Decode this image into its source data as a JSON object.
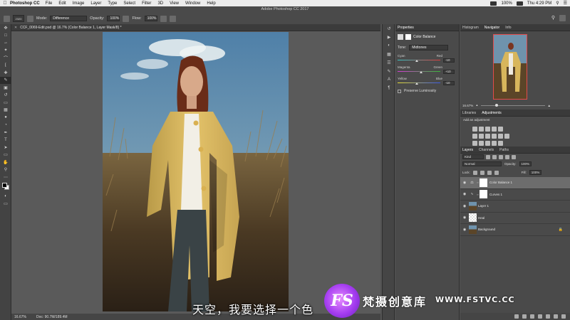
{
  "menubar": {
    "app_name": "Photoshop CC",
    "items": [
      "File",
      "Edit",
      "Image",
      "Layer",
      "Type",
      "Select",
      "Filter",
      "3D",
      "View",
      "Window",
      "Help"
    ],
    "battery": "100%",
    "clock": "Thu 4:29 PM"
  },
  "window_title": "Adobe Photoshop CC 2017",
  "optionsbar": {
    "brush_size": "2320",
    "mode_label": "Mode:",
    "mode_value": "Difference",
    "opacity_label": "Opacity:",
    "opacity_value": "100%",
    "flow_label": "Flow:",
    "flow_value": "100%"
  },
  "document": {
    "tab_label": "CCF_0069-Edit.psd @ 16.7% (Color Balance 1, Layer Mask/8) *"
  },
  "statusbar": {
    "zoom": "16.67%",
    "doc": "Doc: 90.7M/189.4M"
  },
  "properties": {
    "tabs": [
      "Properties"
    ],
    "title": "Color Balance",
    "tone_label": "Tone:",
    "tone_value": "Midtones",
    "sliders": [
      {
        "left": "Cyan",
        "right": "Red",
        "value": "-10",
        "position": 0.45,
        "gradient": [
          "#35c6c6",
          "#e23b3b"
        ]
      },
      {
        "left": "Magenta",
        "right": "Green",
        "value": "+10",
        "position": 0.55,
        "gradient": [
          "#d33ad3",
          "#38b838"
        ]
      },
      {
        "left": "Yellow",
        "right": "Blue",
        "value": "-10",
        "position": 0.45,
        "gradient": [
          "#e6dd33",
          "#3a5ae8"
        ]
      }
    ],
    "preserve_label": "Preserve Luminosity"
  },
  "navigator": {
    "tabs": [
      "Histogram",
      "Navigator",
      "Info"
    ],
    "active": "Navigator",
    "zoom": "16.67%"
  },
  "adjustments": {
    "tabs": [
      "Libraries",
      "Adjustments"
    ],
    "active": "Adjustments",
    "heading": "Add an adjustment"
  },
  "layers": {
    "tabs": [
      "Layers",
      "Channels",
      "Paths"
    ],
    "active": "Layers",
    "filter_label": "Kind",
    "blend_mode": "Normal",
    "opacity_label": "Opacity:",
    "opacity_value": "100%",
    "lock_label": "Lock:",
    "fill_label": "Fill:",
    "fill_value": "100%",
    "items": [
      {
        "name": "Color Balance 1",
        "type": "adjustment",
        "selected": true
      },
      {
        "name": "Curves 1",
        "type": "adjustment",
        "selected": false
      },
      {
        "name": "Layer 1",
        "type": "pixel",
        "selected": false
      },
      {
        "name": "Heal",
        "type": "transparent",
        "selected": false
      },
      {
        "name": "Background",
        "type": "pixel",
        "selected": false,
        "locked": true
      }
    ]
  },
  "subtitle": "天空，我要选择一个色",
  "watermark": {
    "logo": "FS",
    "text": "梵摄创意库",
    "url": "WWW.FSTVC.CC"
  },
  "colors": {
    "accent_selection": "#6d6d6d",
    "nav_frame": "#e24b4b",
    "watermark_purple": "#a43cf0"
  }
}
